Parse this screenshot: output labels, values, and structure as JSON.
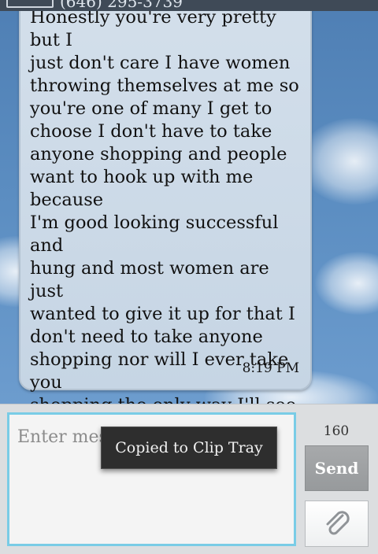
{
  "header": {
    "phone_number": "(646) 295-3739"
  },
  "message": {
    "text": "Honestly you're very pretty but I\njust don't care I have women\nthrowing themselves at me so\nyou're one of many I get to\nchoose I don't have to take\nanyone shopping and people\nwant to hook up with me because\nI'm good looking successful and\nhung and most women are just\nwanted to give it up for that I\ndon't need to take anyone\nshopping nor will I ever take you\nshopping the only way I'll see\nyou again is on your knees\nsucking my cock",
    "time": "8:19 PM"
  },
  "composer": {
    "placeholder": "Enter mess",
    "char_count": "160",
    "send_label": "Send",
    "attach_icon": "paperclip-icon"
  },
  "toast": {
    "text": "Copied to Clip Tray"
  },
  "colors": {
    "background_sky": "#5b8dc1",
    "bubble": "#cddae7",
    "input_border": "#79cce6",
    "send_button": "#9fa1a3",
    "toast": "#2e2e2e"
  }
}
